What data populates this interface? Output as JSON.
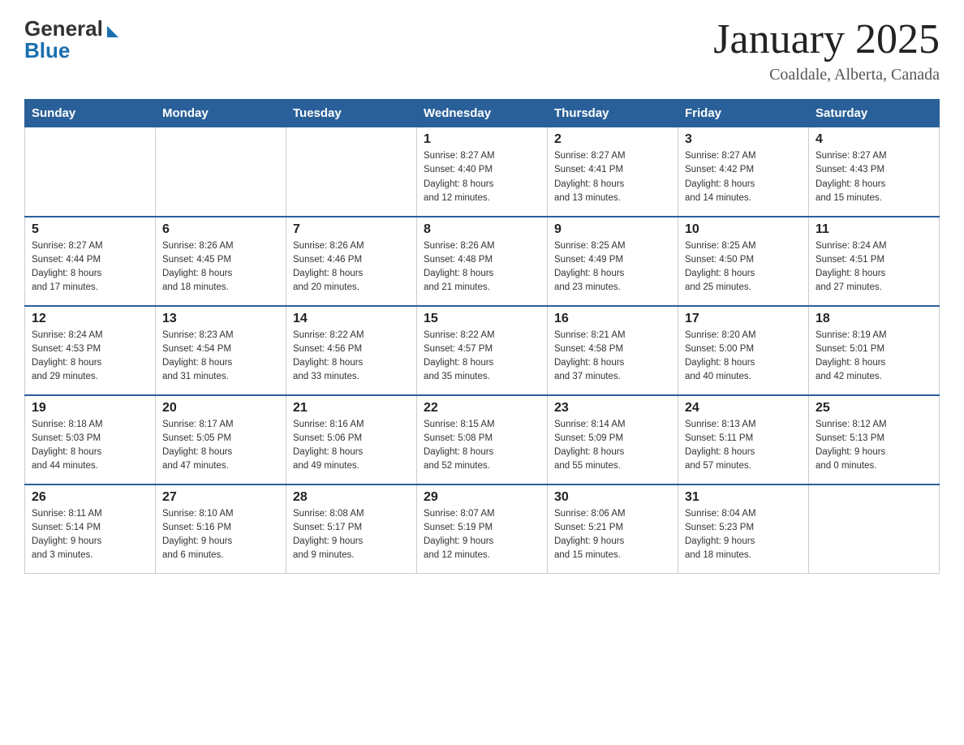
{
  "header": {
    "logo_general": "General",
    "logo_blue": "Blue",
    "month_title": "January 2025",
    "location": "Coaldale, Alberta, Canada"
  },
  "days_of_week": [
    "Sunday",
    "Monday",
    "Tuesday",
    "Wednesday",
    "Thursday",
    "Friday",
    "Saturday"
  ],
  "weeks": [
    [
      {
        "day": "",
        "info": ""
      },
      {
        "day": "",
        "info": ""
      },
      {
        "day": "",
        "info": ""
      },
      {
        "day": "1",
        "info": "Sunrise: 8:27 AM\nSunset: 4:40 PM\nDaylight: 8 hours\nand 12 minutes."
      },
      {
        "day": "2",
        "info": "Sunrise: 8:27 AM\nSunset: 4:41 PM\nDaylight: 8 hours\nand 13 minutes."
      },
      {
        "day": "3",
        "info": "Sunrise: 8:27 AM\nSunset: 4:42 PM\nDaylight: 8 hours\nand 14 minutes."
      },
      {
        "day": "4",
        "info": "Sunrise: 8:27 AM\nSunset: 4:43 PM\nDaylight: 8 hours\nand 15 minutes."
      }
    ],
    [
      {
        "day": "5",
        "info": "Sunrise: 8:27 AM\nSunset: 4:44 PM\nDaylight: 8 hours\nand 17 minutes."
      },
      {
        "day": "6",
        "info": "Sunrise: 8:26 AM\nSunset: 4:45 PM\nDaylight: 8 hours\nand 18 minutes."
      },
      {
        "day": "7",
        "info": "Sunrise: 8:26 AM\nSunset: 4:46 PM\nDaylight: 8 hours\nand 20 minutes."
      },
      {
        "day": "8",
        "info": "Sunrise: 8:26 AM\nSunset: 4:48 PM\nDaylight: 8 hours\nand 21 minutes."
      },
      {
        "day": "9",
        "info": "Sunrise: 8:25 AM\nSunset: 4:49 PM\nDaylight: 8 hours\nand 23 minutes."
      },
      {
        "day": "10",
        "info": "Sunrise: 8:25 AM\nSunset: 4:50 PM\nDaylight: 8 hours\nand 25 minutes."
      },
      {
        "day": "11",
        "info": "Sunrise: 8:24 AM\nSunset: 4:51 PM\nDaylight: 8 hours\nand 27 minutes."
      }
    ],
    [
      {
        "day": "12",
        "info": "Sunrise: 8:24 AM\nSunset: 4:53 PM\nDaylight: 8 hours\nand 29 minutes."
      },
      {
        "day": "13",
        "info": "Sunrise: 8:23 AM\nSunset: 4:54 PM\nDaylight: 8 hours\nand 31 minutes."
      },
      {
        "day": "14",
        "info": "Sunrise: 8:22 AM\nSunset: 4:56 PM\nDaylight: 8 hours\nand 33 minutes."
      },
      {
        "day": "15",
        "info": "Sunrise: 8:22 AM\nSunset: 4:57 PM\nDaylight: 8 hours\nand 35 minutes."
      },
      {
        "day": "16",
        "info": "Sunrise: 8:21 AM\nSunset: 4:58 PM\nDaylight: 8 hours\nand 37 minutes."
      },
      {
        "day": "17",
        "info": "Sunrise: 8:20 AM\nSunset: 5:00 PM\nDaylight: 8 hours\nand 40 minutes."
      },
      {
        "day": "18",
        "info": "Sunrise: 8:19 AM\nSunset: 5:01 PM\nDaylight: 8 hours\nand 42 minutes."
      }
    ],
    [
      {
        "day": "19",
        "info": "Sunrise: 8:18 AM\nSunset: 5:03 PM\nDaylight: 8 hours\nand 44 minutes."
      },
      {
        "day": "20",
        "info": "Sunrise: 8:17 AM\nSunset: 5:05 PM\nDaylight: 8 hours\nand 47 minutes."
      },
      {
        "day": "21",
        "info": "Sunrise: 8:16 AM\nSunset: 5:06 PM\nDaylight: 8 hours\nand 49 minutes."
      },
      {
        "day": "22",
        "info": "Sunrise: 8:15 AM\nSunset: 5:08 PM\nDaylight: 8 hours\nand 52 minutes."
      },
      {
        "day": "23",
        "info": "Sunrise: 8:14 AM\nSunset: 5:09 PM\nDaylight: 8 hours\nand 55 minutes."
      },
      {
        "day": "24",
        "info": "Sunrise: 8:13 AM\nSunset: 5:11 PM\nDaylight: 8 hours\nand 57 minutes."
      },
      {
        "day": "25",
        "info": "Sunrise: 8:12 AM\nSunset: 5:13 PM\nDaylight: 9 hours\nand 0 minutes."
      }
    ],
    [
      {
        "day": "26",
        "info": "Sunrise: 8:11 AM\nSunset: 5:14 PM\nDaylight: 9 hours\nand 3 minutes."
      },
      {
        "day": "27",
        "info": "Sunrise: 8:10 AM\nSunset: 5:16 PM\nDaylight: 9 hours\nand 6 minutes."
      },
      {
        "day": "28",
        "info": "Sunrise: 8:08 AM\nSunset: 5:17 PM\nDaylight: 9 hours\nand 9 minutes."
      },
      {
        "day": "29",
        "info": "Sunrise: 8:07 AM\nSunset: 5:19 PM\nDaylight: 9 hours\nand 12 minutes."
      },
      {
        "day": "30",
        "info": "Sunrise: 8:06 AM\nSunset: 5:21 PM\nDaylight: 9 hours\nand 15 minutes."
      },
      {
        "day": "31",
        "info": "Sunrise: 8:04 AM\nSunset: 5:23 PM\nDaylight: 9 hours\nand 18 minutes."
      },
      {
        "day": "",
        "info": ""
      }
    ]
  ]
}
